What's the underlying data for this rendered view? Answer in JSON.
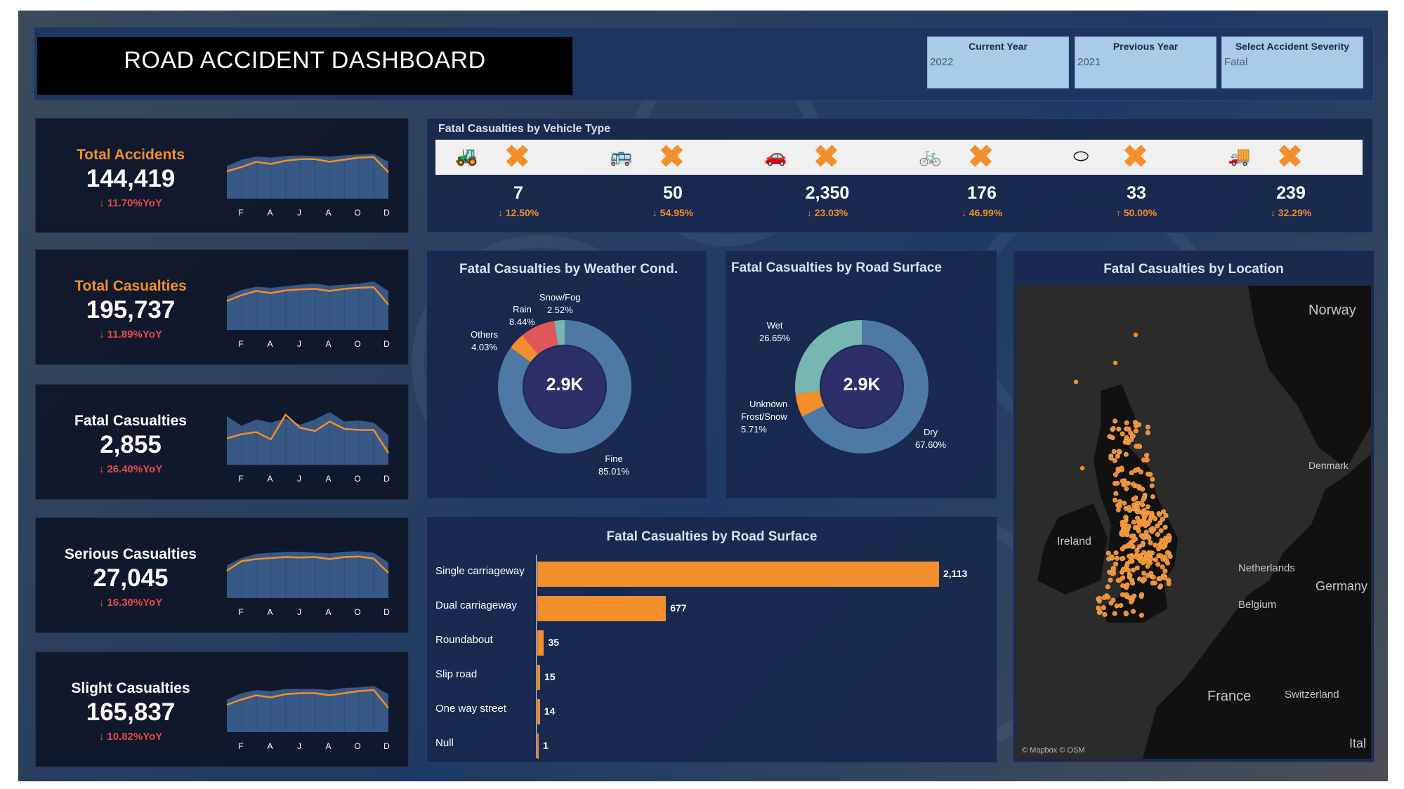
{
  "header": {
    "title": "ROAD ACCIDENT DASHBOARD",
    "filters": [
      {
        "label": "Current Year",
        "value": "2022"
      },
      {
        "label": "Previous Year",
        "value": "2021"
      },
      {
        "label": "Select Accident Severity",
        "value": "Fatal"
      }
    ]
  },
  "kpis": [
    {
      "name": "Total Accidents",
      "value": "144,419",
      "yoy": "11.70%YoY",
      "name_color": "#f28e2b",
      "months": [
        "F",
        "A",
        "J",
        "A",
        "O",
        "D"
      ],
      "area": [
        0.62,
        0.74,
        0.8,
        0.78,
        0.81,
        0.82,
        0.81,
        0.8,
        0.82,
        0.84,
        0.85,
        0.7
      ],
      "line": [
        0.52,
        0.6,
        0.7,
        0.66,
        0.72,
        0.75,
        0.75,
        0.7,
        0.74,
        0.78,
        0.79,
        0.5
      ]
    },
    {
      "name": "Total Casualties",
      "value": "195,737",
      "yoy": "11.89%YoY",
      "name_color": "#f28e2b",
      "months": [
        "F",
        "A",
        "J",
        "A",
        "O",
        "D"
      ],
      "area": [
        0.64,
        0.76,
        0.82,
        0.8,
        0.83,
        0.86,
        0.88,
        0.84,
        0.86,
        0.88,
        0.92,
        0.74
      ],
      "line": [
        0.55,
        0.66,
        0.74,
        0.7,
        0.75,
        0.77,
        0.78,
        0.74,
        0.78,
        0.8,
        0.81,
        0.48
      ]
    },
    {
      "name": "Fatal Casualties",
      "value": "2,855",
      "yoy": "26.40%YoY",
      "name_color": "#ffffff",
      "months": [
        "F",
        "A",
        "J",
        "A",
        "O",
        "D"
      ],
      "area": [
        0.92,
        0.74,
        0.86,
        0.8,
        0.88,
        0.76,
        0.86,
        1.0,
        0.82,
        0.84,
        0.8,
        0.56
      ],
      "line": [
        0.5,
        0.58,
        0.62,
        0.48,
        0.95,
        0.7,
        0.64,
        0.82,
        0.68,
        0.66,
        0.66,
        0.22
      ]
    },
    {
      "name": "Serious Casualties",
      "value": "27,045",
      "yoy": "16.30%YoY",
      "name_color": "#ffffff",
      "months": [
        "F",
        "A",
        "J",
        "A",
        "O",
        "D"
      ],
      "area": [
        0.62,
        0.76,
        0.84,
        0.86,
        0.88,
        0.88,
        0.86,
        0.85,
        0.88,
        0.89,
        0.86,
        0.68
      ],
      "line": [
        0.52,
        0.7,
        0.74,
        0.76,
        0.78,
        0.77,
        0.78,
        0.74,
        0.78,
        0.79,
        0.75,
        0.48
      ]
    },
    {
      "name": "Slight Casualties",
      "value": "165,837",
      "yoy": "10.82%YoY",
      "name_color": "#ffffff",
      "months": [
        "F",
        "A",
        "J",
        "A",
        "O",
        "D"
      ],
      "area": [
        0.62,
        0.74,
        0.8,
        0.78,
        0.82,
        0.82,
        0.82,
        0.8,
        0.84,
        0.85,
        0.88,
        0.72
      ],
      "line": [
        0.52,
        0.62,
        0.7,
        0.66,
        0.72,
        0.74,
        0.74,
        0.7,
        0.74,
        0.78,
        0.8,
        0.46
      ]
    }
  ],
  "vehicle": {
    "title": "Fatal Casualties by Vehicle Type",
    "items": [
      {
        "icon": "tractor-icon",
        "value": "7",
        "yoy": "12.50%",
        "dir": "down"
      },
      {
        "icon": "bus-icon",
        "value": "50",
        "yoy": "54.95%",
        "dir": "down"
      },
      {
        "icon": "car-icon",
        "value": "2,350",
        "yoy": "23.03%",
        "dir": "down"
      },
      {
        "icon": "bicycle-icon",
        "value": "176",
        "yoy": "46.99%",
        "dir": "down"
      },
      {
        "icon": "other-vehicle-icon",
        "value": "33",
        "yoy": "50.00%",
        "dir": "up"
      },
      {
        "icon": "van-icon",
        "value": "239",
        "yoy": "32.29%",
        "dir": "down"
      }
    ]
  },
  "weather": {
    "title": "Fatal Casualties by Weather Cond.",
    "center": "2.9K",
    "labels": [
      {
        "name": "Snow/Fog",
        "pct": "2.52%"
      },
      {
        "name": "Rain",
        "pct": "8.44%"
      },
      {
        "name": "Others",
        "pct": "4.03%"
      },
      {
        "name": "Fine",
        "pct": "85.01%"
      }
    ]
  },
  "surface_donut": {
    "title": "Fatal Casualties by Road Surface",
    "center": "2.9K",
    "labels": [
      {
        "name": "Wet",
        "pct": "26.65%"
      },
      {
        "name": "Unknown",
        "pct": ""
      },
      {
        "name": "Frost/Snow",
        "pct": "5.71%"
      },
      {
        "name": "Dry",
        "pct": "67.60%"
      }
    ]
  },
  "chart_data": [
    {
      "type": "pie",
      "title": "Fatal Casualties by Weather Cond.",
      "categories": [
        "Fine",
        "Others",
        "Rain",
        "Snow/Fog"
      ],
      "values": [
        85.01,
        4.03,
        8.44,
        2.52
      ],
      "colors": [
        "#4e79a7",
        "#f28e2b",
        "#e15759",
        "#76b7b2"
      ]
    },
    {
      "type": "pie",
      "title": "Fatal Casualties by Road Surface",
      "categories": [
        "Dry",
        "Frost/Snow",
        "Wet"
      ],
      "values": [
        67.6,
        5.71,
        26.65
      ],
      "colors": [
        "#4e79a7",
        "#f28e2b",
        "#76b7b2"
      ]
    },
    {
      "type": "bar",
      "title": "Fatal Casualties by Road Surface",
      "categories": [
        "Single carriageway",
        "Dual carriageway",
        "Roundabout",
        "Slip road",
        "One way street",
        "Null"
      ],
      "values": [
        2113,
        677,
        35,
        15,
        14,
        1
      ],
      "value_labels": [
        "2,113",
        "677",
        "35",
        "15",
        "14",
        "1"
      ],
      "xlim": [
        0,
        2113
      ]
    }
  ],
  "map": {
    "title": "Fatal Casualties by Location",
    "labels": [
      "Norway",
      "Denmark",
      "Ireland",
      "Netherlands",
      "Germany",
      "Belgium",
      "France",
      "Switzerland",
      "Ital"
    ],
    "credit": "© Mapbox © OSM"
  },
  "colors": {
    "accent": "#f28e2b",
    "down": "#e5484d",
    "panel": "#1b2d55"
  }
}
